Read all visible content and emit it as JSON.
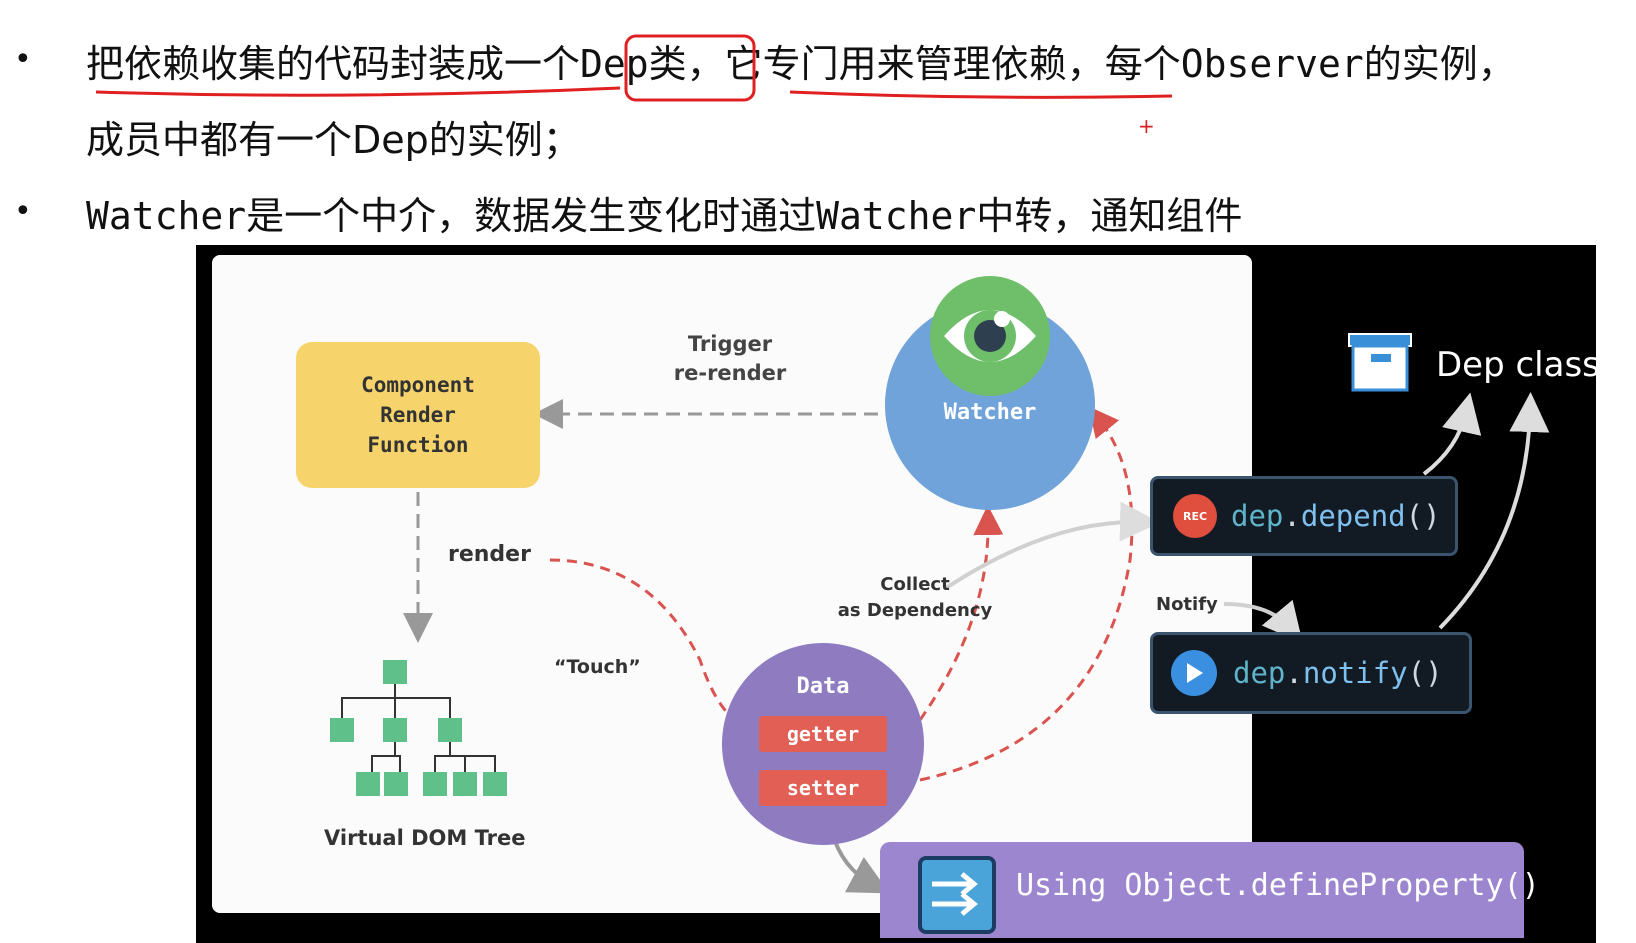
{
  "slide": {
    "bullets": [
      {
        "line1_part1": "把依赖收集的代码封装成一个",
        "line1_highlight": "Dep类",
        "line1_part2": "，",
        "line1_part3": "它专门用来管理依赖",
        "line1_part4": "，每个",
        "line1_code": "Observer",
        "line1_part5": "的实例，",
        "line2": "成员中都有一个Dep的实例；"
      },
      {
        "code": "Watcher",
        "text1": "是一个中介，数据发生变化时通过",
        "code2": "Watcher",
        "text2": "中转，通知组件"
      }
    ],
    "cursor_mark": "+"
  },
  "diagram": {
    "component": [
      "Component",
      "Render",
      "Function"
    ],
    "trigger": [
      "Trigger",
      "re-render"
    ],
    "watcher": "Watcher",
    "render": "render",
    "touch": "“Touch”",
    "collect": [
      "Collect",
      "as Dependency"
    ],
    "notify": "Notify",
    "data": "Data",
    "getter": "getter",
    "setter": "setter",
    "vdom": "Virtual DOM Tree",
    "define_property": "Using Object.defineProperty()",
    "dep_class": "Dep class",
    "rec": "REC",
    "depend_obj": "dep",
    "depend_fn": "depend",
    "notify_obj": "dep",
    "notify_fn": "notify",
    "punct_dot": ".",
    "punct_parens": "()"
  },
  "colors": {
    "component": "#f7d46b",
    "watcher": "#6fa3da",
    "eye": "#6fbf6a",
    "data": "#8e7bc0",
    "pill": "#e15f55",
    "define": "#9c86cf",
    "annotation_red": "#e02020",
    "tree_green": "#5fc08a"
  },
  "icons": [
    "eye-icon",
    "rec-icon",
    "play-icon",
    "box-icon",
    "arrows-icon",
    "tree-icon"
  ]
}
